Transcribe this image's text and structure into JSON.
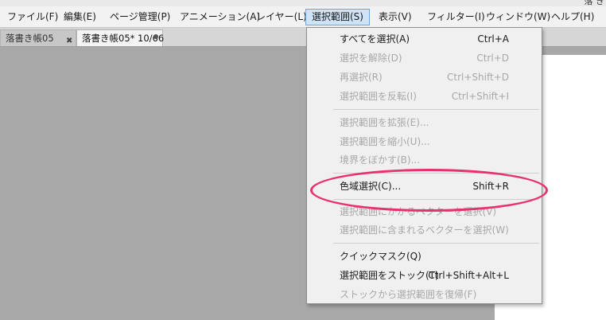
{
  "window": {
    "title_fragment": "落 き"
  },
  "menubar": {
    "items": [
      {
        "label": "ファイル(F)"
      },
      {
        "label": "編集(E)"
      },
      {
        "label": "ページ管理(P)"
      },
      {
        "label": "アニメーション(A)"
      },
      {
        "label": "レイヤー(L)"
      },
      {
        "label": "選択範囲(S)"
      },
      {
        "label": "表示(V)"
      },
      {
        "label": "フィルター(I)"
      },
      {
        "label": "ウィンドウ(W)"
      },
      {
        "label": "ヘルプ(H)"
      }
    ],
    "active_index": 5
  },
  "tabs": [
    {
      "label": "落書き帳05",
      "state": "inactive"
    },
    {
      "label": "落書き帳05* 10/66",
      "state": "active"
    }
  ],
  "dropdown": {
    "items": [
      {
        "label": "すべてを選択(A)",
        "shortcut": "Ctrl+A",
        "enabled": true
      },
      {
        "label": "選択を解除(D)",
        "shortcut": "Ctrl+D",
        "enabled": false
      },
      {
        "label": "再選択(R)",
        "shortcut": "Ctrl+Shift+D",
        "enabled": false
      },
      {
        "label": "選択範囲を反転(I)",
        "shortcut": "Ctrl+Shift+I",
        "enabled": false
      },
      {
        "label": "選択範囲を拡張(E)...",
        "shortcut": "",
        "enabled": false
      },
      {
        "label": "選択範囲を縮小(U)...",
        "shortcut": "",
        "enabled": false
      },
      {
        "label": "境界をぼかす(B)...",
        "shortcut": "",
        "enabled": false
      },
      {
        "label": "色域選択(C)...",
        "shortcut": "Shift+R",
        "enabled": true
      },
      {
        "label": "選択範囲にかかるベクターを選択(V)",
        "shortcut": "",
        "enabled": false
      },
      {
        "label": "選択範囲に含まれるベクターを選択(W)",
        "shortcut": "",
        "enabled": false
      },
      {
        "label": "クイックマスク(Q)",
        "shortcut": "",
        "enabled": true
      },
      {
        "label": "選択範囲をストック(T)",
        "shortcut": "Ctrl+Shift+Alt+L",
        "enabled": true
      },
      {
        "label": "ストックから選択範囲を復帰(F)",
        "shortcut": "",
        "enabled": false
      }
    ]
  },
  "annotation": {
    "color": "#e8326f",
    "target_item": "色域選択(C)..."
  },
  "colors": {
    "menu_active_bg": "#cfe3f7",
    "menu_active_border": "#6ea6dc",
    "canvas_bg": "#a8a8a8",
    "disabled_text": "#a8a8a8"
  }
}
